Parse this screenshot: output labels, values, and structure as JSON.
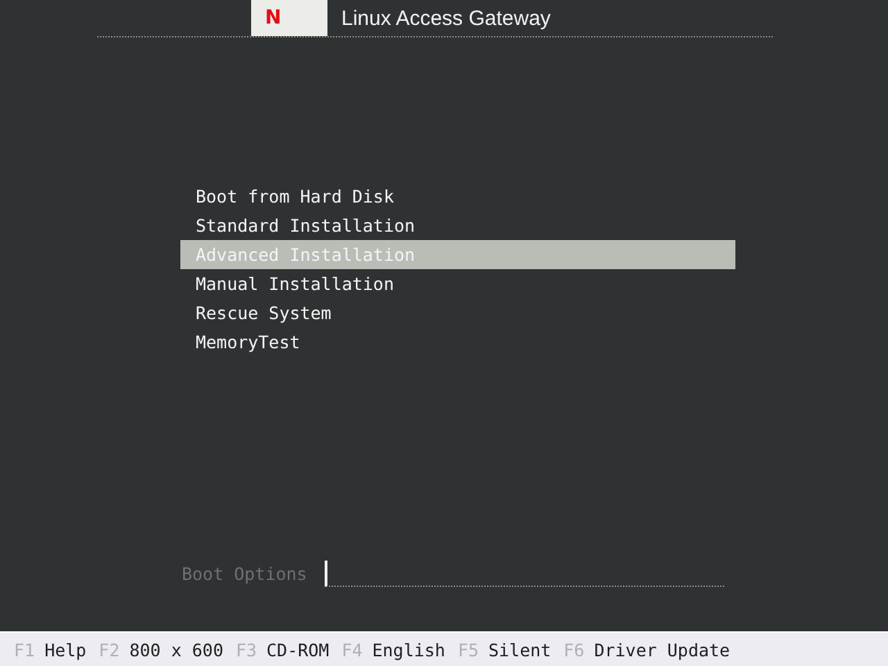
{
  "header": {
    "logo": "N",
    "title": "Linux Access Gateway"
  },
  "menu": [
    {
      "label": "Boot from Hard Disk",
      "selected": false
    },
    {
      "label": "Standard Installation",
      "selected": false
    },
    {
      "label": "Advanced Installation",
      "selected": true
    },
    {
      "label": "Manual Installation",
      "selected": false
    },
    {
      "label": "Rescue System",
      "selected": false
    },
    {
      "label": "MemoryTest",
      "selected": false
    }
  ],
  "boot_options": {
    "label": "Boot Options"
  },
  "function_keys": [
    {
      "key": "F1",
      "label": "Help"
    },
    {
      "key": "F2",
      "label": "800 x 600"
    },
    {
      "key": "F3",
      "label": "CD-ROM"
    },
    {
      "key": "F4",
      "label": "English"
    },
    {
      "key": "F5",
      "label": "Silent"
    },
    {
      "key": "F6",
      "label": "Driver Update"
    }
  ]
}
